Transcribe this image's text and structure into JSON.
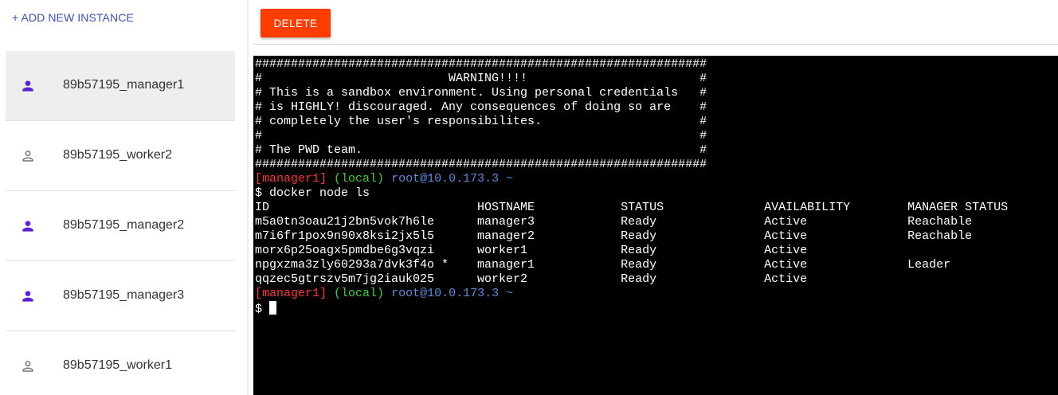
{
  "sidebar": {
    "add_label": "+ ADD NEW INSTANCE",
    "instances": [
      {
        "name": "89b57195_manager1",
        "role": "manager",
        "icon": "person-filled-icon",
        "selected": true
      },
      {
        "name": "89b57195_worker2",
        "role": "worker",
        "icon": "person-outline-icon",
        "selected": false
      },
      {
        "name": "89b57195_manager2",
        "role": "manager",
        "icon": "person-filled-icon",
        "selected": false
      },
      {
        "name": "89b57195_manager3",
        "role": "manager",
        "icon": "person-filled-icon",
        "selected": false
      },
      {
        "name": "89b57195_worker1",
        "role": "worker",
        "icon": "person-outline-icon",
        "selected": false
      }
    ]
  },
  "toolbar": {
    "delete_label": "DELETE"
  },
  "terminal": {
    "banner": [
      "###############################################################",
      "#                          WARNING!!!!                        #",
      "# This is a sandbox environment. Using personal credentials   #",
      "# is HIGHLY! discouraged. Any consequences of doing so are    #",
      "# completely the user's responsibilites.                      #",
      "#                                                             #",
      "# The PWD team.                                               #",
      "###############################################################"
    ],
    "prompt": {
      "host": "[manager1]",
      "local": "(local)",
      "user": "root@10.0.173.3",
      "dir": "~"
    },
    "command": "$ docker node ls",
    "output": [
      "ID                             HOSTNAME            STATUS              AVAILABILITY        MANAGER STATUS",
      "m5a0tn3oau21j2bn5vok7h6le      manager3            Ready               Active              Reachable",
      "m7i6fr1pox9n90x8ksi2jx5l5      manager2            Ready               Active              Reachable",
      "morx6p25oagx5pmdbe6g3vqzi      worker1             Ready               Active",
      "npgxzma3zly60293a7dvk3f4o *    manager1            Ready               Active              Leader",
      "qqzec5gtrszv5m7jg2iauk025      worker2             Ready               Active"
    ],
    "final_prompt": "$ "
  },
  "colors": {
    "accent": "#3f51b5",
    "manager_icon": "#5b21d6",
    "worker_icon": "#757575",
    "delete": "#ff3d00"
  }
}
